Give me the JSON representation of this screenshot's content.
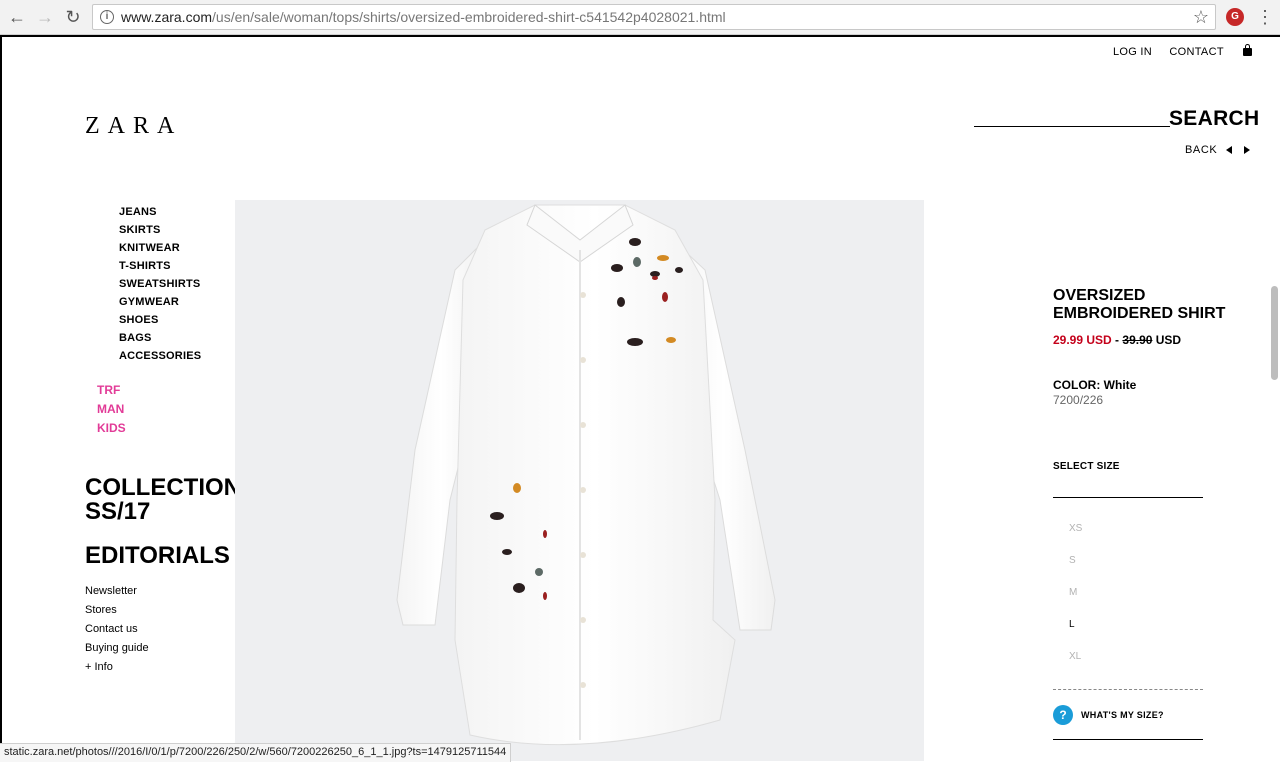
{
  "browser": {
    "url_host": "www.zara.com",
    "url_path": "/us/en/sale/woman/tops/shirts/oversized-embroidered-shirt-c541542p4028021.html",
    "status_url": "static.zara.net/photos///2016/I/0/1/p/7200/226/250/2/w/560/7200226250_6_1_1.jpg?ts=1479125711544"
  },
  "header": {
    "logo": "ZARA",
    "login": "LOG IN",
    "contact": "CONTACT",
    "search": "SEARCH",
    "back": "BACK"
  },
  "nav": {
    "categories": [
      "JEANS",
      "SKIRTS",
      "KNITWEAR",
      "T-SHIRTS",
      "SWEATSHIRTS",
      "GYMWEAR",
      "SHOES",
      "BAGS",
      "ACCESSORIES"
    ],
    "sections": [
      "TRF",
      "MAN",
      "KIDS"
    ],
    "collection_line1": "COLLECTION",
    "collection_line2": "SS/17",
    "editorials": "EDITORIALS",
    "footer_links": [
      "Newsletter",
      "Stores",
      "Contact us",
      "Buying guide",
      "+ Info"
    ]
  },
  "product": {
    "name": "OVERSIZED EMBROIDERED SHIRT",
    "sale_price": "29.99 USD",
    "separator": "-",
    "old_price": "39.90",
    "old_currency": "USD",
    "color_label": "COLOR:",
    "color_value": "White",
    "ref": "7200/226",
    "select_size": "SELECT SIZE",
    "sizes": [
      {
        "label": "XS",
        "available": false
      },
      {
        "label": "S",
        "available": false
      },
      {
        "label": "M",
        "available": false
      },
      {
        "label": "L",
        "available": true
      },
      {
        "label": "XL",
        "available": false
      }
    ],
    "whats_my_size": "WHAT'S MY SIZE?",
    "help_symbol": "?"
  },
  "colors": {
    "sale_red": "#c4001a",
    "section_pink": "#e23b97",
    "help_blue": "#1a9cd8"
  }
}
